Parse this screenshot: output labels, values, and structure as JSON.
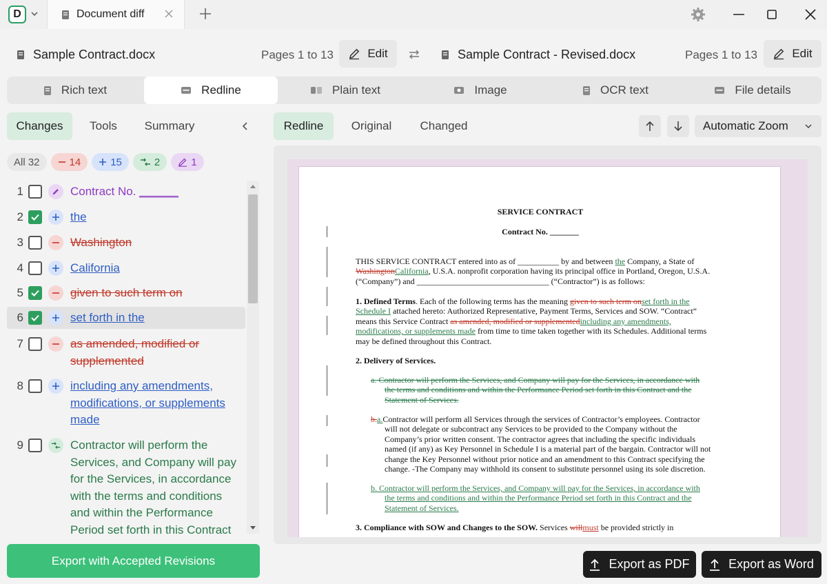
{
  "titlebar": {
    "logo_letter": "D",
    "tab_title": "Document diff"
  },
  "left_file": {
    "name": "Sample Contract.docx",
    "pages": "Pages 1 to 13",
    "edit_label": "Edit"
  },
  "right_file": {
    "name": "Sample Contract - Revised.docx",
    "pages": "Pages 1 to 13",
    "edit_label": "Edit"
  },
  "view_tabs": [
    "Rich text",
    "Redline",
    "Plain text",
    "Image",
    "OCR text",
    "File details"
  ],
  "left_tabs": [
    "Changes",
    "Tools",
    "Summary"
  ],
  "filters": {
    "all": "All 32",
    "deletions": "14",
    "insertions": "15",
    "moves": "2",
    "formatting": "1"
  },
  "changes": [
    {
      "num": "1",
      "type": "fmt",
      "checked": false,
      "text": "Contract No.",
      "text2": "______"
    },
    {
      "num": "2",
      "type": "ins",
      "checked": true,
      "text": "the"
    },
    {
      "num": "3",
      "type": "del",
      "checked": false,
      "text": "Washington"
    },
    {
      "num": "4",
      "type": "ins",
      "checked": false,
      "text": "California"
    },
    {
      "num": "5",
      "type": "del",
      "checked": true,
      "text": "given to such term on"
    },
    {
      "num": "6",
      "type": "ins",
      "checked": true,
      "text": "set forth in the",
      "selected": true
    },
    {
      "num": "7",
      "type": "del",
      "checked": false,
      "text": "as amended, modified or supplemented"
    },
    {
      "num": "8",
      "type": "ins",
      "checked": false,
      "text": "including any amendments, modifications, or supplements made"
    },
    {
      "num": "9",
      "type": "mov",
      "checked": false,
      "text": "Contractor will perform the Services, and Company will pay for the Services, in accordance with the terms and conditions and within the Performance Period set forth in this Contract"
    }
  ],
  "export_accepted_label": "Export with Accepted Revisions",
  "right_tabs": [
    "Redline",
    "Original",
    "Changed"
  ],
  "zoom_label": "Automatic Zoom",
  "export_pdf_label": "Export as PDF",
  "export_word_label": "Export as Word",
  "doc": {
    "title": "SERVICE CONTRACT",
    "contract_no": "Contract No. _______",
    "p1_a": "THIS SERVICE CONTRACT entered into as of __________ by and between",
    "p1_ins_the": "the",
    "p1_b": "Company, a State of",
    "p1_del_wa": "Washington",
    "p1_ins_ca": "California",
    "p1_c": ", U.S.A. nonprofit corporation having its principal office in Portland, Oregon, U.S.A.",
    "p1_d": "(“Company”) and ________________________________ (“Contractor”) is as follows:",
    "s1_head": "1.   Defined Terms",
    "s1_a": ".   Each of the following terms has the meaning",
    "s1_del1": "given to such term on",
    "s1_ins1": "set forth in the",
    "s1_ins1b": "Schedule I",
    "s1_b": "attached hereto:  Authorized Representative, Payment Terms, Services and SOW.  “Contract”",
    "s1_c": "means this Service Contract",
    "s1_del2": "as amended, modified or supplemented",
    "s1_ins2": "including any amendments,",
    "s1_ins2b": "modifications, or supplements made",
    "s1_d": "from time to time taken together with its Schedules.  Additional terms",
    "s1_e": "may be defined throughout this Contract.",
    "s2_head": "2.   Delivery of Services.",
    "s2a_1": "a.    Contractor will perform the Services, and Company will pay for the Services, in accordance with",
    "s2a_2": "the terms and conditions and within the Performance Period set forth in this Contract and the",
    "s2a_3": "Statement of Services.",
    "s2b_del": "b.",
    "s2b_ins": "a.",
    "s2b_1": "Contractor will perform all Services through the services of Contractor’s employees.  Contractor",
    "s2b_2": "will not delegate or subcontract any Services to be provided to the Company without the",
    "s2b_3": "Company’s prior written consent. The contractor agrees that including the specific individuals",
    "s2b_4": "named (if any) as Key Personnel in Schedule I is a material part of the bargain.  Contractor will not",
    "s2b_5": "change the Key Personnel without prior notice and an amendment to this Contract specifying the",
    "s2b_6": "change. -The Company may withhold its consent to substitute personnel using its sole discretion.",
    "s2c_1": "b.    Contractor will perform the Services, and Company will pay for the Services, in accordance with",
    "s2c_2": "the terms and conditions and within the Performance Period set forth in this Contract and the",
    "s2c_3": "Statement of Services.",
    "s3_head": "3.   Compliance with SOW and Changes to the SOW.",
    "s3_a": "Services",
    "s3_del": "will",
    "s3_ins": "must",
    "s3_b": "be provided strictly in"
  },
  "colors": {
    "accent_green": "#3cc07a",
    "delete_red": "#c0392b",
    "insert_blue": "#2f5ec4",
    "move_green": "#2a7a4a",
    "format_purple": "#8d3ac1"
  }
}
